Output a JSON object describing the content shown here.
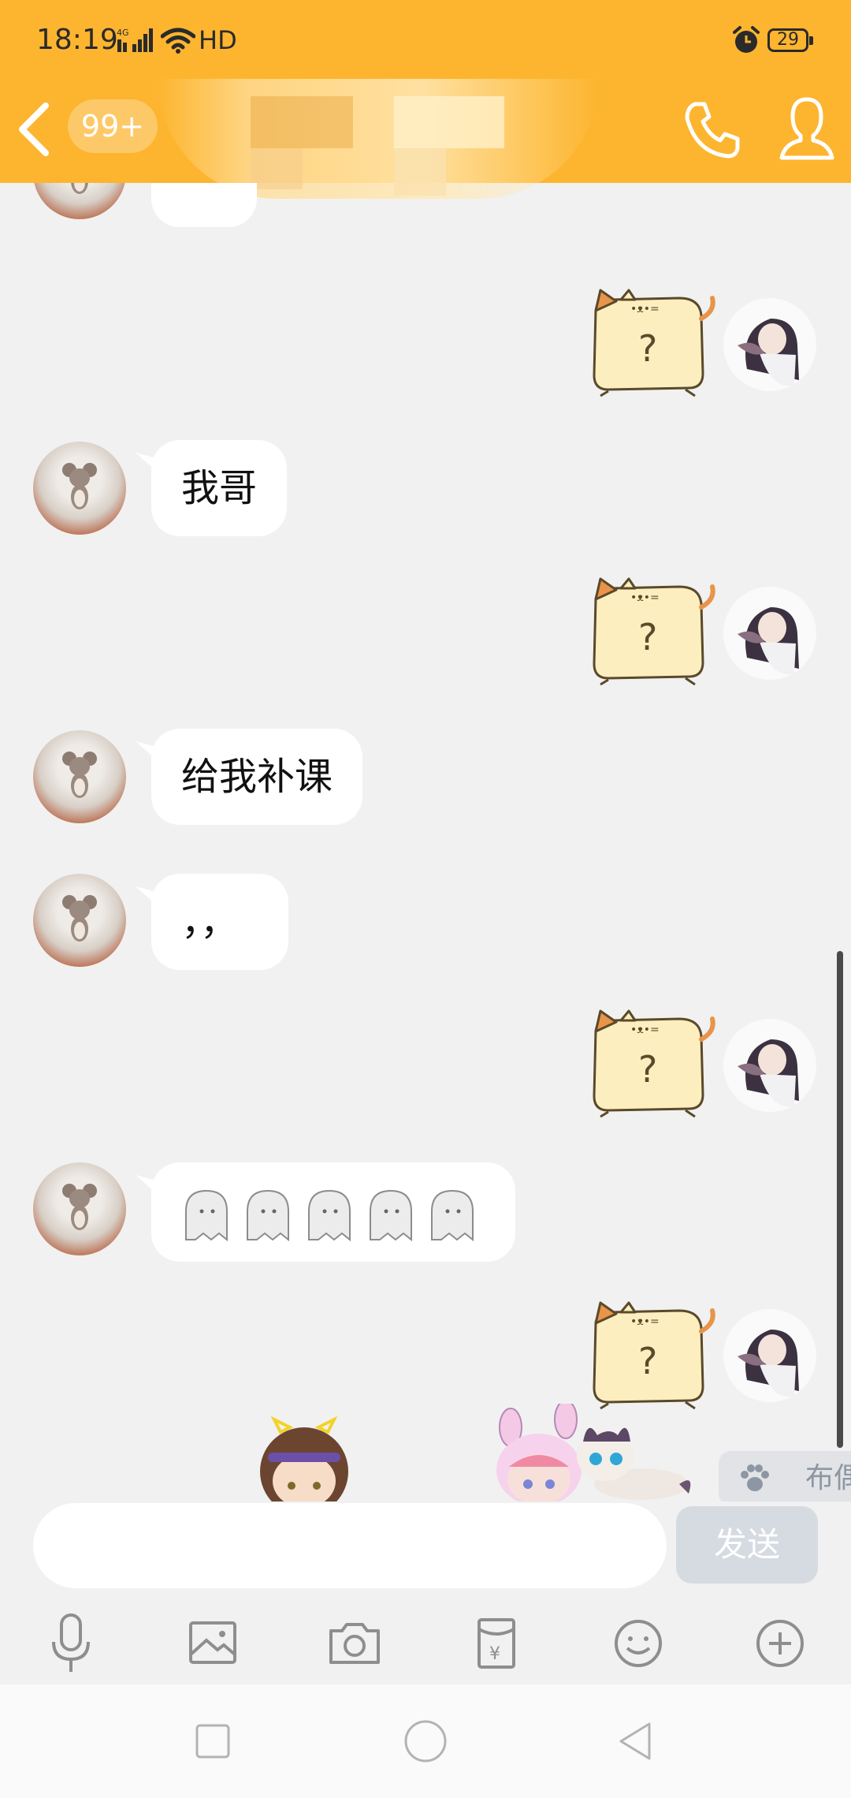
{
  "status_bar": {
    "time": "18:19",
    "network": "4G",
    "hd": "HD",
    "battery": "29"
  },
  "header": {
    "unread_badge": "99+"
  },
  "messages": [
    {
      "side": "left",
      "kind": "text",
      "text": ""
    },
    {
      "side": "right",
      "kind": "sticker",
      "sticker": "cat-question-sticker",
      "text": "?"
    },
    {
      "side": "left",
      "kind": "text",
      "text": "我哥"
    },
    {
      "side": "right",
      "kind": "sticker",
      "sticker": "cat-question-sticker",
      "text": "?"
    },
    {
      "side": "left",
      "kind": "text",
      "text": "给我补课"
    },
    {
      "side": "left",
      "kind": "text",
      "text": "，，"
    },
    {
      "side": "right",
      "kind": "sticker",
      "sticker": "cat-question-sticker",
      "text": "?"
    },
    {
      "side": "left",
      "kind": "emoji",
      "emoji": "ghost-emoji",
      "count": 5
    },
    {
      "side": "right",
      "kind": "sticker",
      "sticker": "cat-question-sticker",
      "text": "?"
    }
  ],
  "paw_chip": {
    "label": "布偶"
  },
  "input": {
    "value": "",
    "placeholder": ""
  },
  "send_button": {
    "label": "发送"
  },
  "toolbar": [
    "microphone-icon",
    "image-icon",
    "camera-icon",
    "red-packet-icon",
    "emoji-icon",
    "plus-icon"
  ],
  "navbar": [
    "square-icon",
    "circle-icon",
    "triangle-back-icon"
  ],
  "colors": {
    "header": "#fdb52f",
    "background": "#f1f1f1",
    "bubble": "#ffffff",
    "send_disabled": "#d5dbe1"
  }
}
